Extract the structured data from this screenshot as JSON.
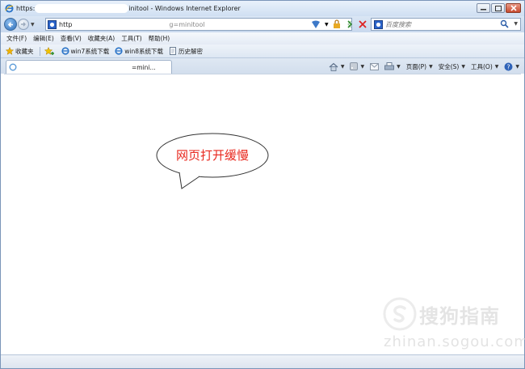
{
  "window": {
    "title_prefix": "https:",
    "title_suffix": "initool - Windows Internet Explorer"
  },
  "address": {
    "url_prefix": "http",
    "url_suffix": "g=minitool"
  },
  "search": {
    "placeholder": "百度搜索"
  },
  "menu": [
    "文件(F)",
    "编辑(E)",
    "查看(V)",
    "收藏夹(A)",
    "工具(T)",
    "帮助(H)"
  ],
  "favorites": {
    "favorites_label": "收藏夹",
    "items": [
      "win7系统下载",
      "win8系统下载",
      "历史解密"
    ]
  },
  "tab": {
    "label_suffix": "=mini..."
  },
  "commands": {
    "page": "页面(P)",
    "safety": "安全(S)",
    "tools": "工具(O)"
  },
  "content": {
    "bubble_text": "网页打开缓慢"
  },
  "watermark": {
    "brand": "搜狗指南",
    "url": "zhinan.sogou.com"
  },
  "colors": {
    "bubble_text": "#e8281e",
    "chrome": "#cfdff2"
  }
}
